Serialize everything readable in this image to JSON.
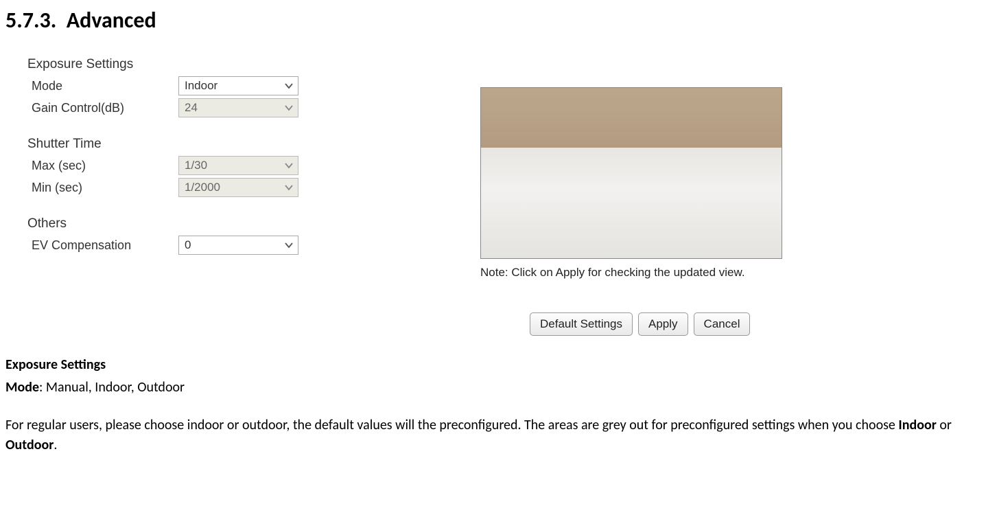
{
  "section_number": "5.7.3.",
  "section_title": "Advanced",
  "exposure": {
    "heading": "Exposure Settings",
    "mode_label": "Mode",
    "mode_value": "Indoor",
    "gain_label": "Gain Control(dB)",
    "gain_value": "24"
  },
  "shutter": {
    "heading": "Shutter Time",
    "max_label": "Max (sec)",
    "max_value": "1/30",
    "min_label": "Min (sec)",
    "min_value": "1/2000"
  },
  "others": {
    "heading": "Others",
    "ev_label": "EV Compensation",
    "ev_value": "0"
  },
  "note_text": "Note: Click on Apply for checking the updated view.",
  "buttons": {
    "default": "Default Settings",
    "apply": "Apply",
    "cancel": "Cancel"
  },
  "body": {
    "h1": "Exposure Settings",
    "mode_label": "Mode",
    "mode_options": ": Manual, Indoor, Outdoor",
    "para_part1": "For regular users, please choose indoor or outdoor, the default values will the preconfigured. The areas are grey out for preconfigured settings when you choose ",
    "indoor": "Indoor",
    "or_text": " or ",
    "outdoor": "Outdoor",
    "period": "."
  }
}
